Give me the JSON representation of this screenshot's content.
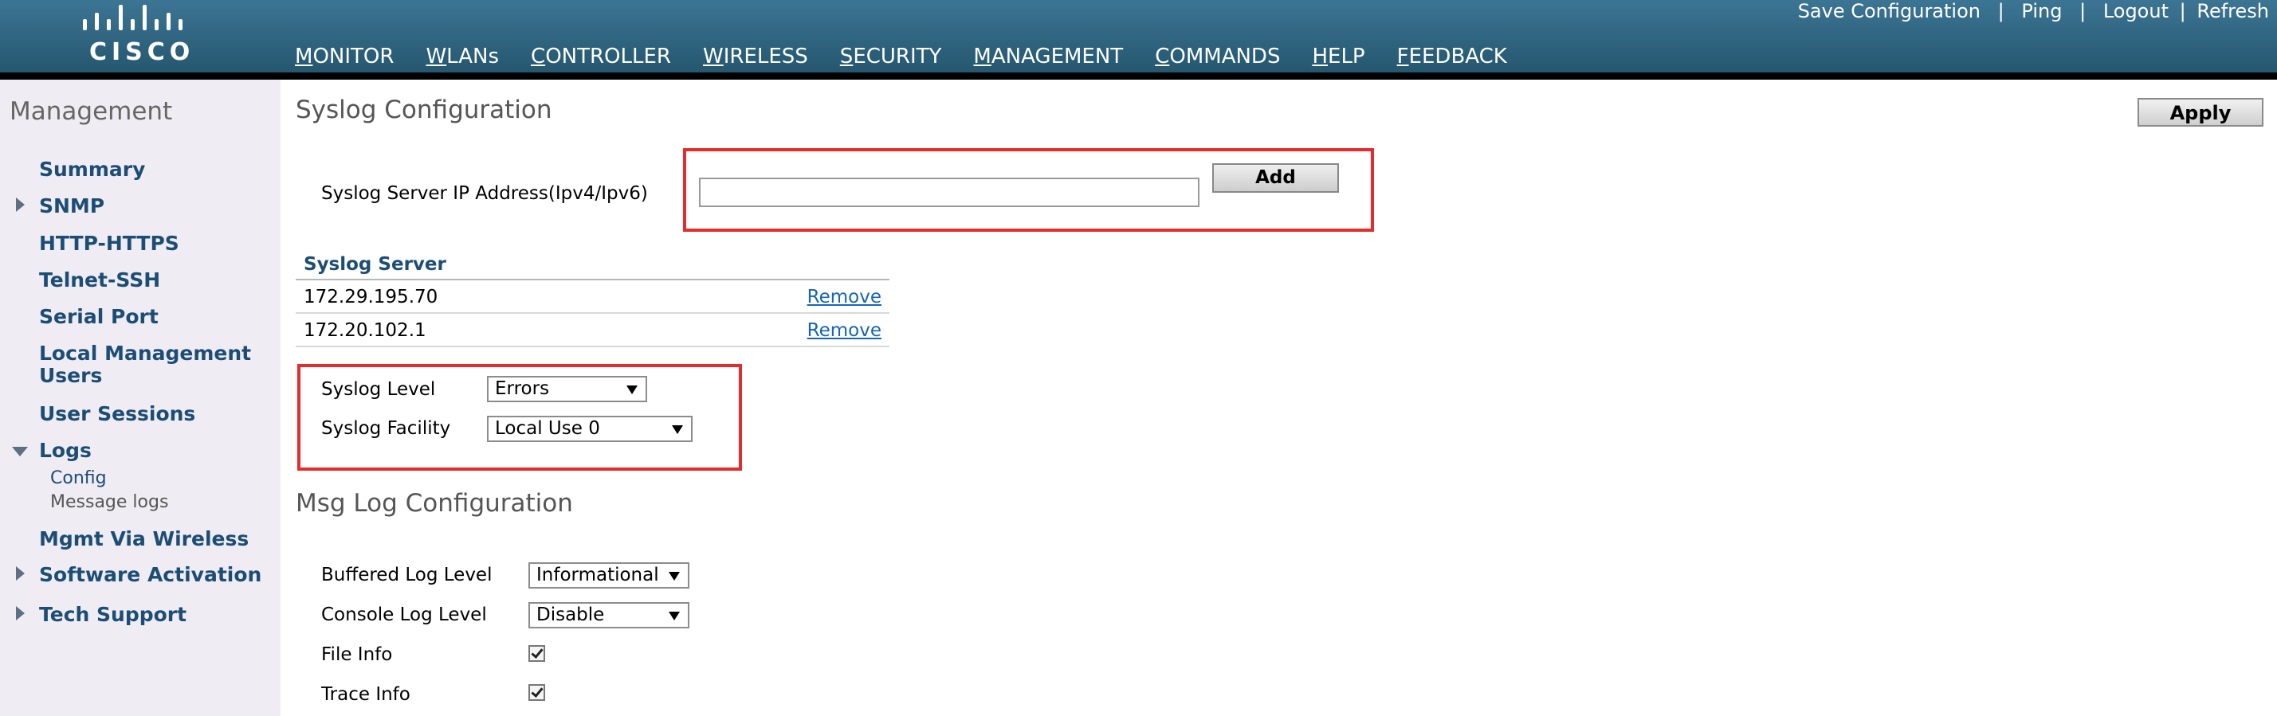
{
  "brand": {
    "logo_text": "CISCO"
  },
  "topnav": [
    {
      "first": "M",
      "rest": "ONITOR",
      "active": false
    },
    {
      "first": "W",
      "rest": "LANs",
      "active": false
    },
    {
      "first": "C",
      "rest": "ONTROLLER",
      "active": false
    },
    {
      "first": "W",
      "rest": "IRELESS",
      "active": false
    },
    {
      "first": "S",
      "rest": "ECURITY",
      "active": false
    },
    {
      "first": "M",
      "rest": "ANAGEMENT",
      "active": true
    },
    {
      "first": "C",
      "rest": "OMMANDS",
      "active": false
    },
    {
      "first": "H",
      "rest": "ELP",
      "active": false
    },
    {
      "first": "F",
      "rest": "EEDBACK",
      "active": false
    }
  ],
  "toplinks": {
    "save": "Save Configuration",
    "ping": "Ping",
    "logout": "Logout",
    "refresh": "Refresh",
    "separator": "|"
  },
  "sidebar": {
    "title": "Management",
    "items": {
      "summary": "Summary",
      "snmp": "SNMP",
      "http": "HTTP-HTTPS",
      "telnet": "Telnet-SSH",
      "serial": "Serial Port",
      "local_mgmt_1": "Local Management",
      "local_mgmt_2": "Users",
      "user_sessions": "User Sessions",
      "logs": "Logs",
      "config": "Config",
      "message_logs": "Message logs",
      "mgmt_wireless": "Mgmt Via Wireless",
      "software_activation": "Software Activation",
      "tech_support": "Tech Support"
    }
  },
  "page": {
    "title": "Syslog Configuration",
    "apply_label": "Apply",
    "syslog_ip_label": "Syslog Server IP Address(Ipv4/Ipv6)",
    "syslog_ip_value": "",
    "add_label": "Add",
    "server_table": {
      "header": "Syslog Server",
      "rows": [
        {
          "ip": "172.29.195.70",
          "action": "Remove"
        },
        {
          "ip": "172.20.102.1",
          "action": "Remove"
        }
      ]
    },
    "syslog_level_label": "Syslog Level",
    "syslog_level_value": "Errors",
    "syslog_facility_label": "Syslog Facility",
    "syslog_facility_value": "Local Use 0",
    "msg_log_title": "Msg Log Configuration",
    "buffered_label": "Buffered Log Level",
    "buffered_value": "Informational",
    "console_label": "Console Log Level",
    "console_value": "Disable",
    "file_info_label": "File Info",
    "file_info_checked": true,
    "trace_info_label": "Trace Info",
    "trace_info_checked": true
  },
  "colors": {
    "header_top": "#3c7594",
    "header_bottom": "#25576f",
    "active_tab": "#f29220",
    "sidebar_bg": "#f0ecf3",
    "nav_link": "#1c4d75",
    "highlight_box": "#e52b2b"
  }
}
